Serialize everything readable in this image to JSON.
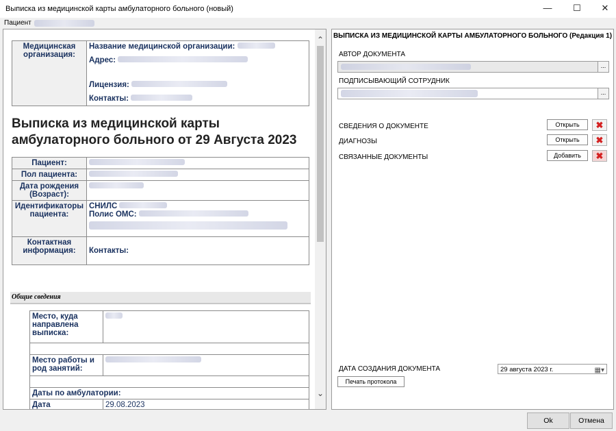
{
  "window": {
    "title": "Выписка из медицинской карты амбулаторного больного (новый)",
    "min": "—",
    "max": "☐",
    "close": "✕"
  },
  "patient_bar": {
    "label": "Пациент"
  },
  "document": {
    "org": {
      "label": "Медицинская организация:",
      "name_label": "Название медицинской организации:",
      "address_label": "Адрес:",
      "license_label": "Лицензия:",
      "contacts_label": "Контакты:"
    },
    "heading": "Выписка из медицинской карты амбулаторного больного от 29 Августа 2023",
    "patient": {
      "patient_label": "Пациент:",
      "sex_label": "Пол пациента:",
      "dob_label": "Дата рождения (Возраст):",
      "ids_label": "Идентификаторы пациента:",
      "snils_label": "СНИЛС",
      "oms_label": "Полис ОМС:",
      "contact_label": "Контактная информация:",
      "contacts_label": "Контакты:"
    },
    "section_title": "Общие сведения",
    "general": {
      "dest_label": "Место, куда направлена выписка:",
      "work_label": "Место работы и род занятий:",
      "dates_label": "Даты по амбулатории:",
      "date_label": "Дата",
      "date_value": "29.08.2023"
    }
  },
  "right": {
    "header": "ВЫПИСКА ИЗ МЕДИЦИНСКОЙ КАРТЫ АМБУЛАТОРНОГО БОЛЬНОГО (Редакция 1)",
    "author_label": "АВТОР ДОКУМЕНТА",
    "signer_label": "ПОДПИСЫВАЮЩИЙ СОТРУДНИК",
    "dots": "...",
    "rows": [
      {
        "label": "СВЕДЕНИЯ О ДОКУМЕНТЕ",
        "button": "Открыть"
      },
      {
        "label": "ДИАГНОЗЫ",
        "button": "Открыть"
      },
      {
        "label": "СВЯЗАННЫЕ ДОКУМЕНТЫ",
        "button": "Добавить"
      }
    ],
    "delete_glyph": "✖",
    "created_label": "ДАТА СОЗДАНИЯ ДОКУМЕНТА",
    "created_value": "29  августа  2023 г.",
    "calendar_glyph": "▦▾",
    "print_button": "Печать протокола"
  },
  "footer": {
    "ok": "Ok",
    "cancel": "Отмена"
  }
}
